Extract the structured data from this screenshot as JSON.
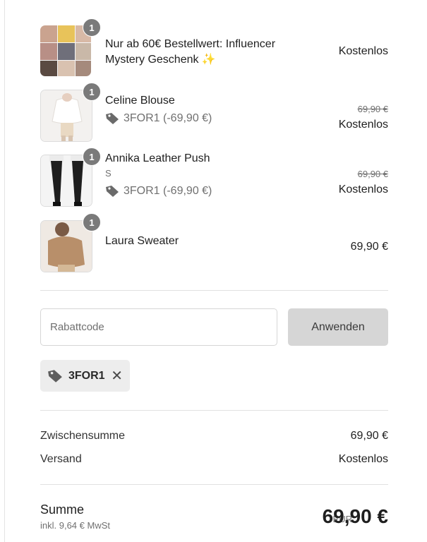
{
  "items": [
    {
      "quantity": "1",
      "name_line1": "Nur ab 60€ Bestellwert: Influencer",
      "name_line2": "Mystery Geschenk ✨",
      "price": "Kostenlos",
      "image": "collage-thumbnail"
    },
    {
      "quantity": "1",
      "name": "Celine Blouse",
      "discount": "3FOR1 (-69,90 €)",
      "original_price": "69,90 €",
      "price": "Kostenlos",
      "image": "white-blouse-thumbnail"
    },
    {
      "quantity": "1",
      "name": "Annika Leather Push",
      "variant": "S",
      "discount": "3FOR1 (-69,90 €)",
      "original_price": "69,90 €",
      "price": "Kostenlos",
      "image": "black-leather-pants-thumbnail"
    },
    {
      "quantity": "1",
      "name": "Laura Sweater",
      "price": "69,90 €",
      "image": "beige-sweater-thumbnail"
    }
  ],
  "discount_form": {
    "placeholder": "Rabattcode",
    "value": "",
    "apply_label": "Anwenden"
  },
  "applied_code": {
    "code": "3FOR1",
    "remove_icon": "close-icon"
  },
  "summary": {
    "subtotal_label": "Zwischensumme",
    "subtotal_value": "69,90 €",
    "shipping_label": "Versand",
    "shipping_value": "Kostenlos"
  },
  "total": {
    "label": "Summe",
    "tax_note": "inkl. 9,64 € MwSt",
    "currency": "EUR",
    "value": "69,90 €"
  },
  "colors": {
    "badge": "#7a7a7a",
    "apply_button": "#d6d6d6",
    "chip": "#ededed",
    "muted_text": "#707070"
  }
}
